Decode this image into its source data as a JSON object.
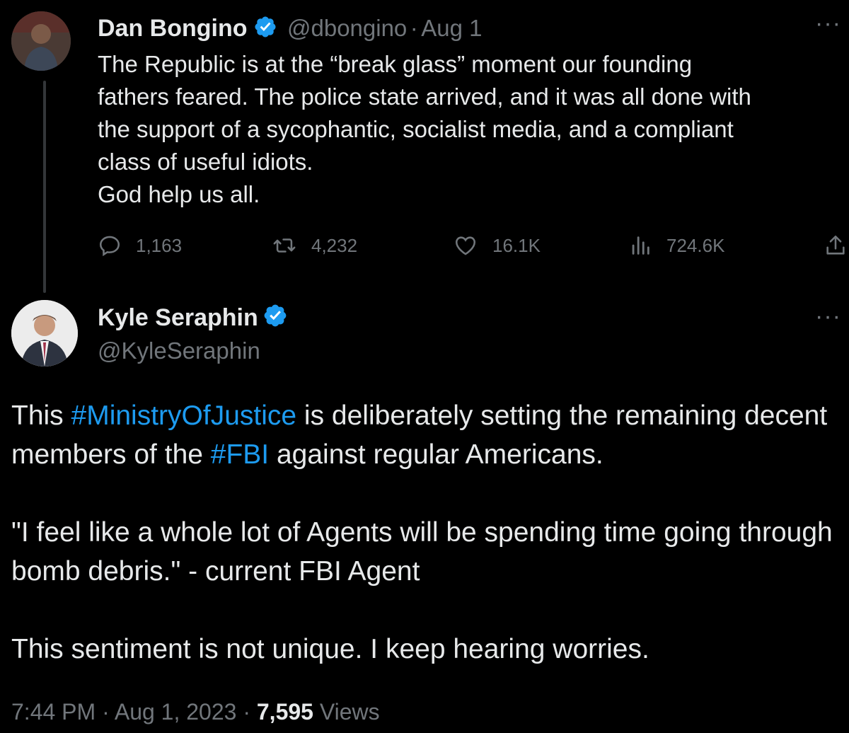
{
  "tweet1": {
    "author_name": "Dan Bongino",
    "handle": "@dbongino",
    "separator": "·",
    "date": "Aug 1",
    "text": "The Republic is at the “break glass” moment our founding\nfathers feared. The police state arrived, and it was all done with\nthe support of a sycophantic, socialist media, and a compliant\nclass of useful idiots.\nGod help us all.",
    "stats": {
      "replies": "1,163",
      "retweets": "4,232",
      "likes": "16.1K",
      "views": "724.6K"
    }
  },
  "tweet2": {
    "author_name": "Kyle Seraphin",
    "handle": "@KyleSeraphin",
    "para1": {
      "pre": "This ",
      "hashtag1": "#MinistryOfJustice",
      "mid": " is deliberately setting the remaining decent members of the ",
      "hashtag2": "#FBI",
      "post": " against regular Americans."
    },
    "para2": "\"I feel like a whole lot of Agents will be spending time going through bomb debris.\" - current FBI Agent",
    "para3": "This sentiment is not unique. I keep hearing worries.",
    "meta": {
      "time": "7:44 PM",
      "separator": " · ",
      "date": "Aug 1, 2023",
      "views_count": "7,595",
      "views_label": " Views"
    }
  },
  "more_glyph": "···",
  "colors": {
    "background": "#000000",
    "text": "#e7e9ea",
    "secondary": "#71767b",
    "hashtag": "#1d9bf0",
    "verified": "#1d9bf0"
  }
}
